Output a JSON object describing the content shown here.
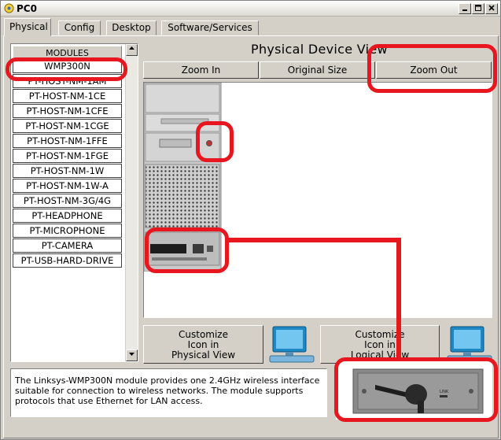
{
  "window": {
    "title": "PC0"
  },
  "tabs": [
    {
      "label": "Physical",
      "active": true
    },
    {
      "label": "Config",
      "active": false
    },
    {
      "label": "Desktop",
      "active": false
    },
    {
      "label": "Software/Services",
      "active": false
    }
  ],
  "modules": {
    "header": "MODULES",
    "items": [
      "WMP300N",
      "PT-HOST-NM-1AM",
      "PT-HOST-NM-1CE",
      "PT-HOST-NM-1CFE",
      "PT-HOST-NM-1CGE",
      "PT-HOST-NM-1FFE",
      "PT-HOST-NM-1FGE",
      "PT-HOST-NM-1W",
      "PT-HOST-NM-1W-A",
      "PT-HOST-NM-3G/4G",
      "PT-HEADPHONE",
      "PT-MICROPHONE",
      "PT-CAMERA",
      "PT-USB-HARD-DRIVE"
    ]
  },
  "physical_view": {
    "title": "Physical Device View",
    "zoom_in": "Zoom In",
    "original_size": "Original Size",
    "zoom_out": "Zoom Out"
  },
  "customize": {
    "physical_line1": "Customize",
    "physical_line2": "Icon in",
    "physical_line3": "Physical View",
    "logical_line1": "Customize",
    "logical_line2": "Icon in",
    "logical_line3": "Logical View"
  },
  "description": "The Linksys-WMP300N module provides one 2.4GHz wireless interface suitable for connection to wireless networks. The module supports protocols that use Ethernet for LAN access.",
  "module_image": {
    "label": "LINK"
  },
  "colors": {
    "annotation": "#e8161f",
    "window_bg": "#d4d0c8"
  }
}
